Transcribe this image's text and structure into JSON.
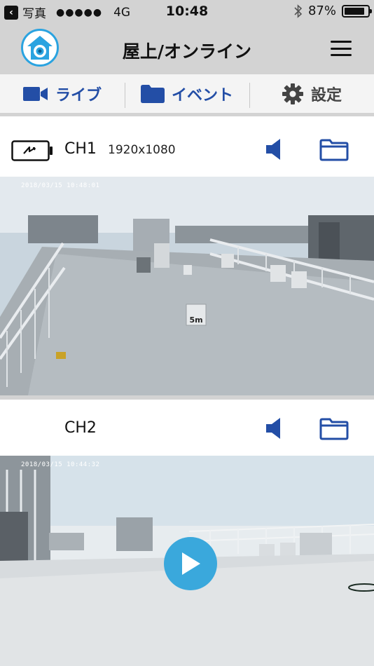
{
  "status_bar": {
    "back_app": "写真",
    "signal": "●●●●●",
    "network": "4G",
    "time": "10:48",
    "battery_text": "87%",
    "battery_level": 0.87
  },
  "header": {
    "title": "屋上/オンライン"
  },
  "tabs": [
    {
      "label": "ライブ",
      "icon": "camera-icon"
    },
    {
      "label": "イベント",
      "icon": "folder-icon"
    },
    {
      "label": "設定",
      "icon": "gear-icon"
    }
  ],
  "channels": [
    {
      "name": "CH1",
      "resolution": "1920x1080",
      "timestamp": "2018/03/15 10:48:01",
      "sign_text": "5m"
    },
    {
      "name": "CH2",
      "resolution": "",
      "timestamp": "2018/03/15 10:44:32"
    }
  ],
  "colors": {
    "accent_blue": "#234ea6",
    "play_blue": "#3aa8dc",
    "bar_gray": "#d3d3d3"
  }
}
